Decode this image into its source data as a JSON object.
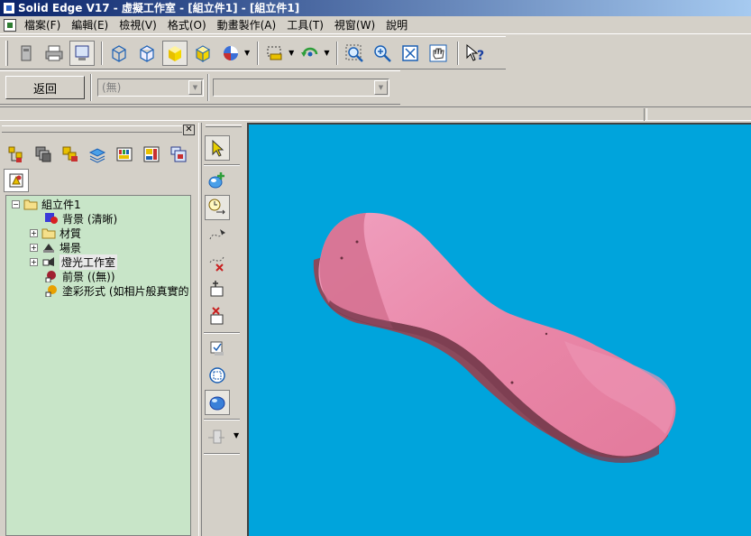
{
  "window": {
    "title": "Solid Edge V17 - 虛擬工作室 - [組立件1] - [組立件1]"
  },
  "menu": [
    "檔案(F)",
    "編輯(E)",
    "檢視(V)",
    "格式(O)",
    "動畫製作(A)",
    "工具(T)",
    "視窗(W)",
    "說明"
  ],
  "toolbar2": {
    "back_label": "返回",
    "combo1_value": "(無)",
    "combo2_value": ""
  },
  "tree": {
    "root": "組立件1",
    "items": [
      {
        "label": "背景 (清晰)",
        "icon": "background-icon",
        "expandable": false
      },
      {
        "label": "材質",
        "icon": "folder-icon",
        "expandable": true
      },
      {
        "label": "場景",
        "icon": "scene-icon",
        "expandable": true
      },
      {
        "label": "燈光工作室",
        "icon": "light-icon",
        "expandable": true,
        "highlighted": true
      },
      {
        "label": "前景 ((無))",
        "icon": "foreground-icon",
        "expandable": false
      },
      {
        "label": "塗彩形式 (如相片般真實的",
        "icon": "paint-style-icon",
        "expandable": false
      }
    ]
  },
  "colors": {
    "viewport_bg": "#00a4dc",
    "model": "#e87fa0",
    "tree_bg": "#c8e5c8",
    "title_start": "#0a246a",
    "title_end": "#a6caf0"
  }
}
